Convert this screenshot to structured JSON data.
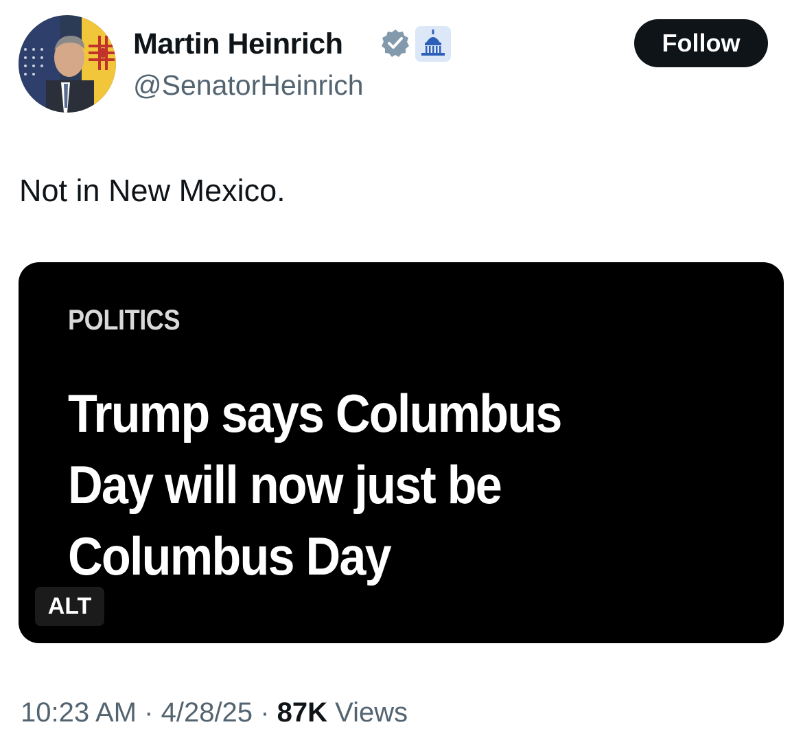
{
  "author": {
    "display_name": "Martin Heinrich",
    "handle": "@SenatorHeinrich",
    "avatar_icon": "profile-photo",
    "verified_icon": "verified-badge-icon",
    "affiliation_icon": "capitol-building-icon"
  },
  "follow_button": {
    "label": "Follow"
  },
  "tweet": {
    "text": "Not in New Mexico."
  },
  "media": {
    "category": "POLITICS",
    "headline_lines": [
      "Trump says Columbus",
      "Day will now just be",
      "Columbus Day"
    ],
    "alt_label": "ALT"
  },
  "meta": {
    "time": "10:23 AM",
    "separator": "·",
    "date": "4/28/25",
    "views_count": "87K",
    "views_label": "Views"
  },
  "colors": {
    "text_primary": "#0f1419",
    "text_secondary": "#536471",
    "verified_gray": "#829aab",
    "follow_bg": "#0f1419",
    "media_bg": "#000000"
  }
}
